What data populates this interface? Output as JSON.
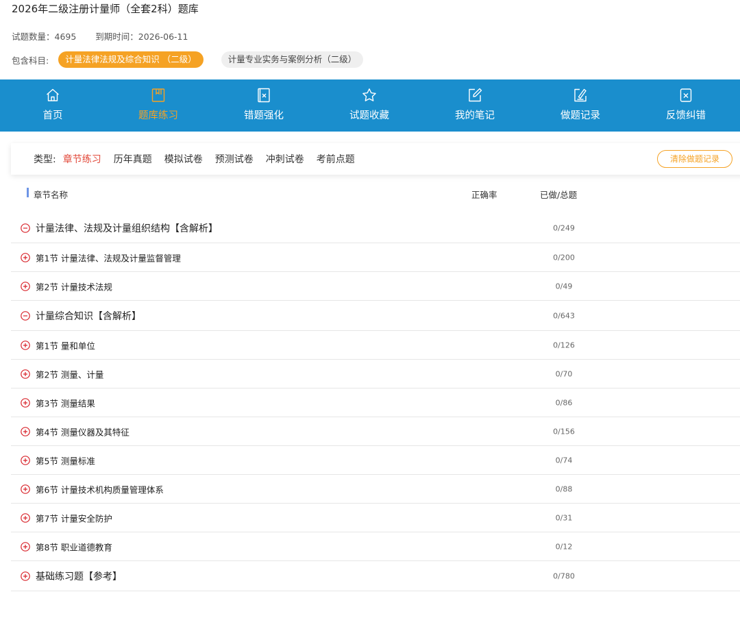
{
  "header": {
    "title": "2026年二级注册计量师（全套2科）题库",
    "question_count": "试题数量：4695",
    "expiry": "到期时间：2026-06-11",
    "subjects_label": "包含科目:",
    "subjects": [
      {
        "label": "计量法律法规及综合知识 （二级）",
        "active": true
      },
      {
        "label": "计量专业实务与案例分析（二级）",
        "active": false
      }
    ]
  },
  "nav": [
    {
      "label": "首页",
      "icon": "home-icon"
    },
    {
      "label": "题库练习",
      "icon": "bookmark-icon",
      "active": true
    },
    {
      "label": "错题强化",
      "icon": "wrong-book-icon"
    },
    {
      "label": "试题收藏",
      "icon": "star-icon"
    },
    {
      "label": "我的笔记",
      "icon": "edit-note-icon"
    },
    {
      "label": "做题记录",
      "icon": "record-icon"
    },
    {
      "label": "反馈纠错",
      "icon": "feedback-icon"
    }
  ],
  "types": {
    "label": "类型:",
    "tabs": [
      "章节练习",
      "历年真题",
      "模拟试卷",
      "预测试卷",
      "冲刺试卷",
      "考前点题"
    ],
    "active_index": 0,
    "clear_label": "清除做题记录"
  },
  "table": {
    "col_name": "章节名称",
    "col_rate": "正确率",
    "col_done": "已做/总题",
    "rows": [
      {
        "name": "计量法律、法规及计量组织结构【含解析】",
        "done": "0/249",
        "chapter": true,
        "expanded": true
      },
      {
        "name": "第1节 计量法律、法规及计量监督管理",
        "done": "0/200"
      },
      {
        "name": "第2节 计量技术法规",
        "done": "0/49"
      },
      {
        "name": "计量综合知识【含解析】",
        "done": "0/643",
        "chapter": true,
        "expanded": true
      },
      {
        "name": "第1节 量和单位",
        "done": "0/126"
      },
      {
        "name": "第2节 测量、计量",
        "done": "0/70"
      },
      {
        "name": "第3节 测量结果",
        "done": "0/86"
      },
      {
        "name": "第4节 测量仪器及其特征",
        "done": "0/156"
      },
      {
        "name": "第5节 测量标准",
        "done": "0/74"
      },
      {
        "name": "第6节 计量技术机构质量管理体系",
        "done": "0/88"
      },
      {
        "name": "第7节 计量安全防护",
        "done": "0/31"
      },
      {
        "name": "第8节 职业道德教育",
        "done": "0/12"
      },
      {
        "name": "基础练习题【参考】",
        "done": "0/780",
        "chapter": true,
        "expanded": false
      }
    ]
  },
  "colors": {
    "brand_blue": "#1a8ecd",
    "accent_orange": "#f5a224",
    "active_red": "#e24a3b",
    "icon_red": "#d8232a"
  }
}
